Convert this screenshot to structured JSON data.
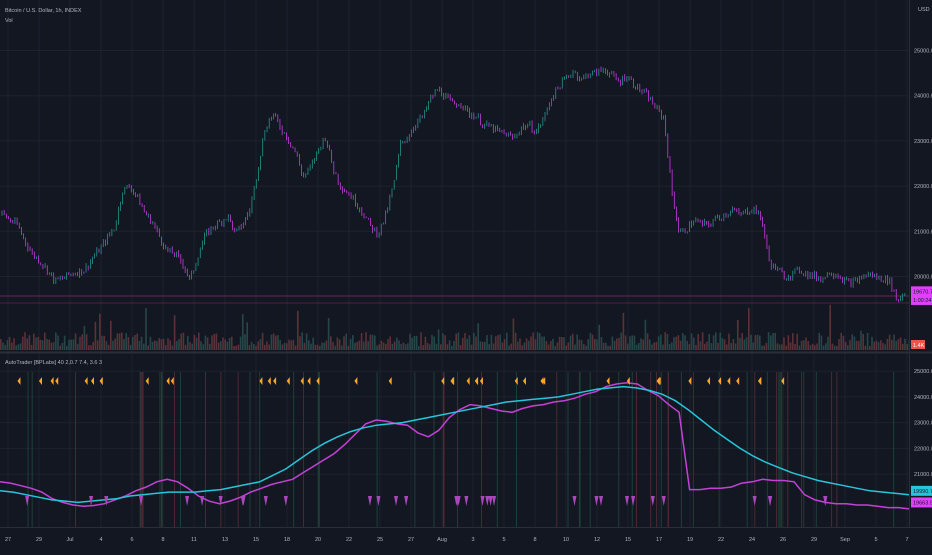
{
  "header": {
    "symbol_line": "Bitcoin / U.S. Dollar, 1h, INDEX",
    "sub_line": "Vol",
    "currency": "USD"
  },
  "indicator": {
    "title": "AutoTrader [BPLabs] 40 2,0.7 7.4, 3.6 3"
  },
  "price_axis": {
    "ticks": [
      {
        "value": 25000,
        "label": "25000.00"
      },
      {
        "value": 24000,
        "label": "24000.00"
      },
      {
        "value": 23000,
        "label": "23000.00"
      },
      {
        "value": 22000,
        "label": "22000.00"
      },
      {
        "value": 21000,
        "label": "21000.00"
      },
      {
        "value": 20000,
        "label": "20000.00"
      }
    ],
    "badges": [
      {
        "value": 19670,
        "label": "19670.70",
        "color": "#e040fb"
      },
      {
        "value": 19480,
        "label": "1:00:24",
        "color": "#e040fb"
      }
    ],
    "vol_badge": {
      "label": "1.4K",
      "color": "#ef5350"
    }
  },
  "indicator_axis": {
    "ticks": [
      {
        "value": 25000,
        "label": "25000.00"
      },
      {
        "value": 24000,
        "label": "24000.00"
      },
      {
        "value": 23000,
        "label": "23000.00"
      },
      {
        "value": 22000,
        "label": "22000.00"
      },
      {
        "value": 21000,
        "label": "21000.00"
      }
    ],
    "badges": [
      {
        "value": 20350,
        "label": "19990.72",
        "color": "#26c6da"
      },
      {
        "value": 19900,
        "label": "19663.92",
        "color": "#e040fb"
      }
    ]
  },
  "time_axis": {
    "labels": [
      "27",
      "29",
      "Jul",
      "4",
      "6",
      "8",
      "11",
      "13",
      "15",
      "18",
      "20",
      "22",
      "25",
      "27",
      "Aug",
      "3",
      "5",
      "8",
      "10",
      "12",
      "15",
      "17",
      "19",
      "22",
      "24",
      "26",
      "29",
      "Sep",
      "5",
      "7"
    ]
  },
  "colors": {
    "bg": "#131722",
    "grid": "#1e222d",
    "up": "#26a69a",
    "down": "#e040fb",
    "fast_line": "#c441d6",
    "slow_line": "#26c6da",
    "buy_marker": "#ffa726",
    "sell_marker": "#ab47bc"
  },
  "chart_data": {
    "type": "line",
    "price_series": {
      "range": [
        19500,
        25100
      ],
      "points": [
        21400,
        21250,
        21150,
        20800,
        20500,
        20350,
        20150,
        19900,
        19950,
        20050,
        20100,
        20150,
        20400,
        20600,
        20850,
        21100,
        21900,
        22000,
        21750,
        21400,
        21200,
        20850,
        20550,
        20500,
        20300,
        19900,
        20450,
        20900,
        21100,
        21200,
        21350,
        20950,
        21150,
        21500,
        22400,
        23300,
        23600,
        23300,
        23050,
        22750,
        22200,
        22400,
        22800,
        23100,
        22400,
        22000,
        21850,
        21650,
        21400,
        21100,
        20950,
        21350,
        22000,
        22950,
        23100,
        23400,
        23550,
        23950,
        24150,
        23950,
        23800,
        23850,
        23600,
        23550,
        23350,
        23300,
        23200,
        23150,
        23050,
        23300,
        23350,
        23200,
        23500,
        23950,
        24200,
        24400,
        24550,
        24350,
        24500,
        24500,
        24600,
        24450,
        24300,
        24450,
        24250,
        24100,
        23950,
        23700,
        23500,
        21900,
        20950,
        21050,
        21250,
        21150,
        21150,
        21300,
        21350,
        21500,
        21350,
        21450,
        21500,
        21250,
        20300,
        20150,
        20000,
        20050,
        20150,
        20050,
        20000,
        19950,
        20100,
        20050,
        19900,
        19850,
        19950,
        20050,
        20000,
        19950,
        19900,
        19450,
        19670
      ]
    },
    "fast_line": {
      "range": [
        19600,
        24700
      ],
      "points": [
        20700,
        20650,
        20550,
        20450,
        20300,
        20050,
        19900,
        19800,
        19750,
        19780,
        19850,
        20000,
        20150,
        20350,
        20500,
        20700,
        20800,
        20700,
        20450,
        20150,
        19950,
        19850,
        19950,
        20100,
        20300,
        20450,
        20600,
        20700,
        20800,
        21050,
        21300,
        21550,
        21800,
        22150,
        22550,
        22950,
        23100,
        23050,
        22950,
        22900,
        22600,
        22450,
        22700,
        23200,
        23500,
        23700,
        23650,
        23550,
        23450,
        23400,
        23550,
        23650,
        23700,
        23800,
        23850,
        23950,
        24100,
        24200,
        24400,
        24500,
        24550,
        24500,
        24250,
        24050,
        23700,
        23400,
        20400,
        20400,
        20450,
        20450,
        20500,
        20650,
        20700,
        20800,
        20750,
        20750,
        20700,
        20200,
        20000,
        19900,
        19850,
        19850,
        19800,
        19800,
        19750,
        19700,
        19700,
        19650
      ]
    },
    "slow_line": {
      "range": [
        19600,
        24700
      ],
      "points": [
        20350,
        20300,
        20200,
        20100,
        20000,
        19950,
        19900,
        19950,
        20000,
        20050,
        20150,
        20200,
        20250,
        20300,
        20300,
        20300,
        20350,
        20400,
        20500,
        20600,
        20700,
        20950,
        21200,
        21550,
        21900,
        22200,
        22450,
        22650,
        22800,
        22900,
        22950,
        23000,
        23100,
        23200,
        23300,
        23400,
        23500,
        23600,
        23700,
        23800,
        23850,
        23900,
        23950,
        24000,
        24100,
        24200,
        24300,
        24350,
        24400,
        24350,
        24250,
        24100,
        23850,
        23500,
        23100,
        22700,
        22350,
        22000,
        21700,
        21450,
        21250,
        21050,
        20900,
        20750,
        20650,
        20550,
        20450,
        20350,
        20300,
        20250,
        20200
      ]
    },
    "markers": {
      "buy_count": 44,
      "sell_count": 35
    }
  }
}
